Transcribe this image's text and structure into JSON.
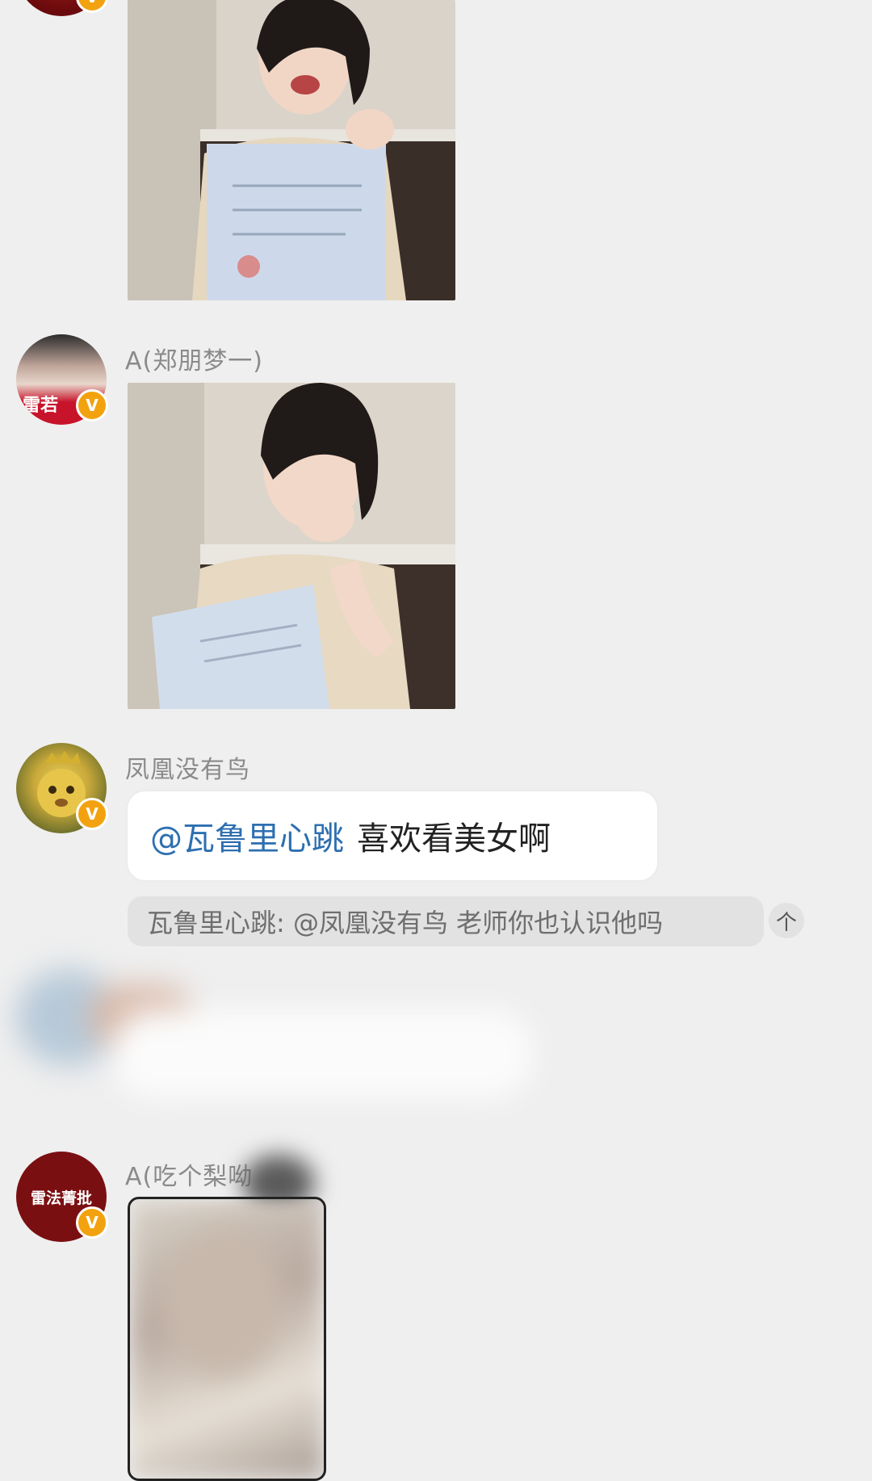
{
  "messages": [
    {
      "id": "msg1",
      "sender": "",
      "type": "image",
      "badge": "V"
    },
    {
      "id": "msg2",
      "sender": "A(郑朋梦一)",
      "type": "image",
      "avatar_text": "雷若",
      "badge": "V"
    },
    {
      "id": "msg3",
      "sender": "凤凰没有鸟",
      "type": "text",
      "mention": "@瓦鲁里心跳",
      "text": "喜欢看美女啊",
      "badge": "V",
      "quote": {
        "text": "瓦鲁里心跳: @凤凰没有鸟 老师你也认识他吗",
        "arrow_icon": "up-arrow-icon",
        "arrow_glyph": "个"
      }
    },
    {
      "id": "msg5",
      "sender": "A(吃个梨呦",
      "type": "image",
      "avatar_text": "雷法菁批",
      "badge": "V"
    }
  ],
  "colors": {
    "background": "#efefef",
    "badge": "#f3a20f",
    "mention": "#2d6fb0",
    "avatar_red": "#7a0f12"
  }
}
